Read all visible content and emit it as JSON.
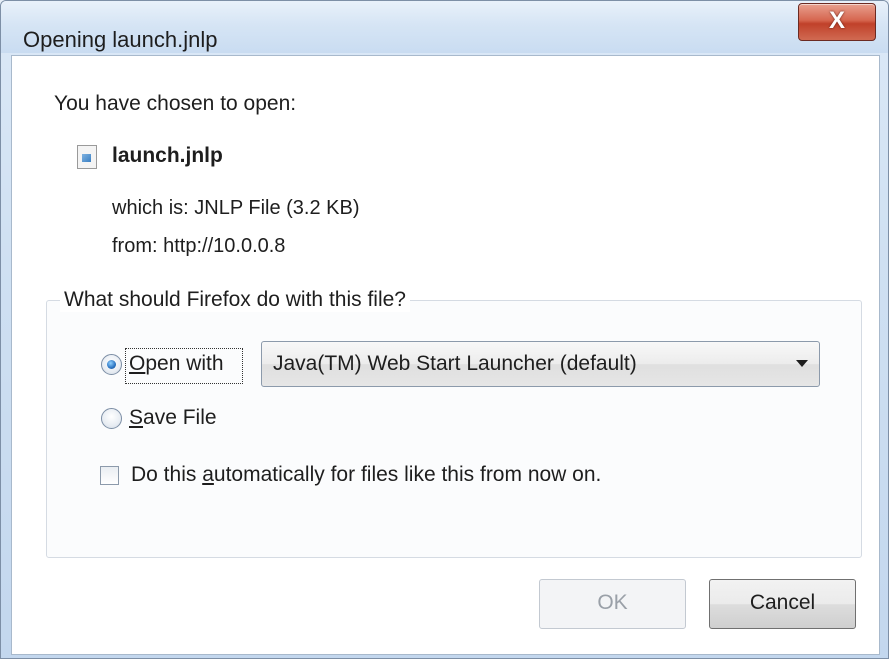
{
  "window": {
    "title": "Opening launch.jnlp",
    "close_glyph": "X"
  },
  "dialog": {
    "intro": "You have chosen to open:",
    "file_icon": "document-icon",
    "file_name": "launch.jnlp",
    "which_is": "which is:  JNLP File (3.2 KB)",
    "from": "from:  http://10.0.0.8"
  },
  "action_group": {
    "legend": "What should Firefox do with this file?",
    "open_with": {
      "label_mnemonic": "O",
      "label_rest": "pen with",
      "selected": true
    },
    "app_select": {
      "value": "Java(TM) Web Start Launcher (default)"
    },
    "save_file": {
      "label_mnemonic": "S",
      "label_rest": "ave File",
      "selected": false
    },
    "auto_checkbox": {
      "label_before": "Do this ",
      "label_mnemonic": "a",
      "label_after": "utomatically for files like this from now on.",
      "checked": false
    }
  },
  "buttons": {
    "ok": "OK",
    "cancel": "Cancel"
  }
}
